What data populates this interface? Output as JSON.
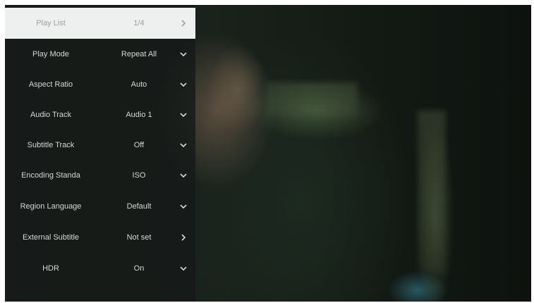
{
  "menu": {
    "items": [
      {
        "label": "Play List",
        "value": "1/4",
        "icon": "chevron-right-icon",
        "selected": true
      },
      {
        "label": "Play Mode",
        "value": "Repeat All",
        "icon": "chevron-down-icon",
        "selected": false
      },
      {
        "label": "Aspect Ratio",
        "value": "Auto",
        "icon": "chevron-down-icon",
        "selected": false
      },
      {
        "label": "Audio Track",
        "value": "Audio 1",
        "icon": "chevron-down-icon",
        "selected": false
      },
      {
        "label": "Subtitle Track",
        "value": "Off",
        "icon": "chevron-down-icon",
        "selected": false
      },
      {
        "label": "Encoding Standa",
        "value": "ISO",
        "icon": "chevron-down-icon",
        "selected": false
      },
      {
        "label": "Region Language",
        "value": "Default",
        "icon": "chevron-down-icon",
        "selected": false
      },
      {
        "label": "External Subtitle",
        "value": "Not set",
        "icon": "chevron-right-icon",
        "selected": false
      },
      {
        "label": "HDR",
        "value": "On",
        "icon": "chevron-down-icon",
        "selected": false
      }
    ]
  },
  "colors": {
    "menu_background": "#161a18",
    "selected_background": "#eef0ef",
    "text": "#d5d8d6",
    "selected_text": "#9aa09e"
  }
}
